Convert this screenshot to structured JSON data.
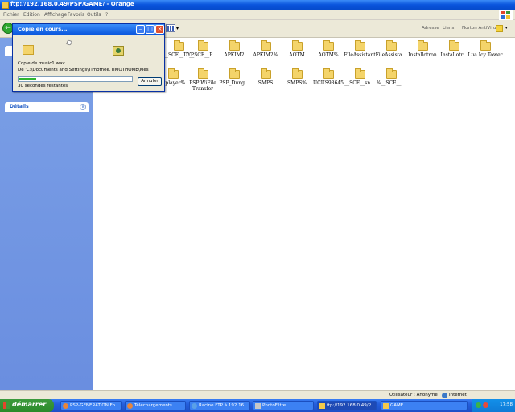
{
  "window": {
    "title": "ftp://192.168.0.49/PSP/GAME/ - Orange"
  },
  "menu": [
    "Fichier",
    "Edition",
    "Affichage",
    "Favoris",
    "Outils",
    "?"
  ],
  "toolbar": {
    "address_label": "Adresse",
    "links_label": "Liens",
    "antivirus_label": "Norton AntiVirus"
  },
  "left_pane": {
    "details_label": "Détails"
  },
  "content": {
    "items": [
      {
        "label": "__SCE__DYP"
      },
      {
        "label": "__SCE__P..."
      },
      {
        "label": "APKIM2"
      },
      {
        "label": "APKIM2%"
      },
      {
        "label": "AOTM"
      },
      {
        "label": "AOTM%"
      },
      {
        "label": "FileAssistant"
      },
      {
        "label": "FileAssista..."
      },
      {
        "label": "Installotron"
      },
      {
        "label": "Installotr..."
      },
      {
        "label": "Lua Icy Tower"
      },
      {
        "label": "...player%"
      },
      {
        "label": "PSP WiFile Transfer"
      },
      {
        "label": "PSP_Dung..."
      },
      {
        "label": "SMPS"
      },
      {
        "label": "SMPS%"
      },
      {
        "label": "UCUS98645"
      },
      {
        "label": "__SCE__sn..."
      },
      {
        "label": "%__SCE__..."
      }
    ]
  },
  "dialog": {
    "title": "Copie en cours...",
    "file_line": "Copie de music1.wav",
    "path_line": "De 'C:\\Documents and Settings\\Timothée.TIMOTHOME\\Mes",
    "progress": 0.15,
    "remaining": "30 secondes restantes",
    "cancel_label": "Annuler"
  },
  "statusbar": {
    "user": "Utilisateur : Anonyme",
    "zone": "Internet"
  },
  "taskbar": {
    "start_label": "démarrer",
    "tasks": [
      {
        "label": "PSP-GENERATION Fo..."
      },
      {
        "label": "Téléchargements"
      },
      {
        "label": "Racine FTP à 192.16..."
      },
      {
        "label": "PhotoFiltre"
      },
      {
        "label": "ftp://192.168.0.49/P..."
      },
      {
        "label": "GAME"
      }
    ],
    "clock": "17:58"
  }
}
